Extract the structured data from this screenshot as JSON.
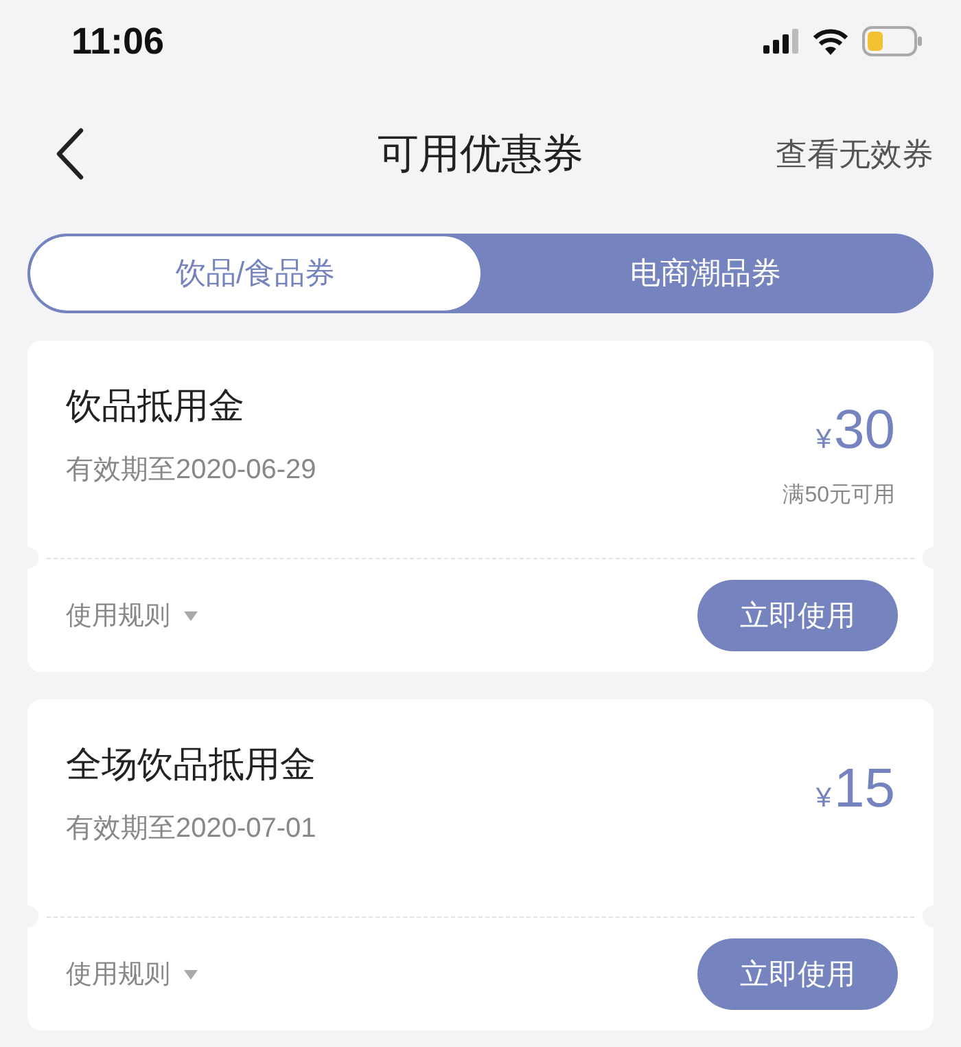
{
  "status_bar": {
    "time": "11:06"
  },
  "nav": {
    "title": "可用优惠券",
    "action": "查看无效券"
  },
  "tabs": [
    {
      "label": "饮品/食品券",
      "selected": true
    },
    {
      "label": "电商潮品券",
      "selected": false
    }
  ],
  "coupons": [
    {
      "title": "饮品抵用金",
      "validity": "有效期至2020-06-29",
      "currency": "¥",
      "amount": "30",
      "condition": "满50元可用",
      "rules": "使用规则",
      "button": "立即使用"
    },
    {
      "title": "全场饮品抵用金",
      "validity": "有效期至2020-07-01",
      "currency": "¥",
      "amount": "15",
      "rules": "使用规则",
      "button": "立即使用"
    }
  ]
}
